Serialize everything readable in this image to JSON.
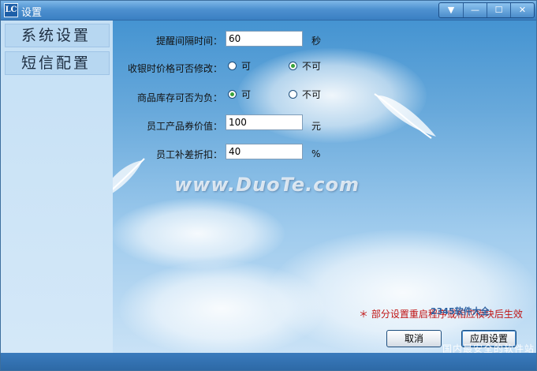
{
  "window": {
    "title": "设置"
  },
  "titlebar_buttons": [
    {
      "name": "dropdown",
      "glyph": "▼"
    },
    {
      "name": "minimize",
      "glyph": "—"
    },
    {
      "name": "maximize",
      "glyph": "☐"
    },
    {
      "name": "close",
      "glyph": "✕"
    }
  ],
  "sidebar": {
    "items": [
      {
        "label": "系统设置"
      },
      {
        "label": "短信配置"
      }
    ]
  },
  "form": {
    "reminder_interval": {
      "label": "提醒间隔时间：",
      "value": "60",
      "unit": "秒"
    },
    "price_modify": {
      "label": "收银时价格可否修改：",
      "options": [
        "可",
        "不可"
      ],
      "selected": "不可"
    },
    "stock_negative": {
      "label": "商品库存可否为负：",
      "options": [
        "可",
        "不可"
      ],
      "selected": "可"
    },
    "voucher_value": {
      "label": "员工产品券价值：",
      "value": "100",
      "unit": "元"
    },
    "discount": {
      "label": "员工补差折扣：",
      "value": "40",
      "unit": "%"
    }
  },
  "note": "＊ 部分设置重启程序或相应模块后生效",
  "buttons": {
    "cancel": "取消",
    "apply": "应用设置"
  },
  "watermark": "www.DuoTe.com",
  "corner_logo": "2345软件大全",
  "corner_sub": "国内最安全的软件站",
  "colors": {
    "titlebar": "#4e91d0",
    "note": "#c01414",
    "radio_dot": "#3aa23a"
  }
}
